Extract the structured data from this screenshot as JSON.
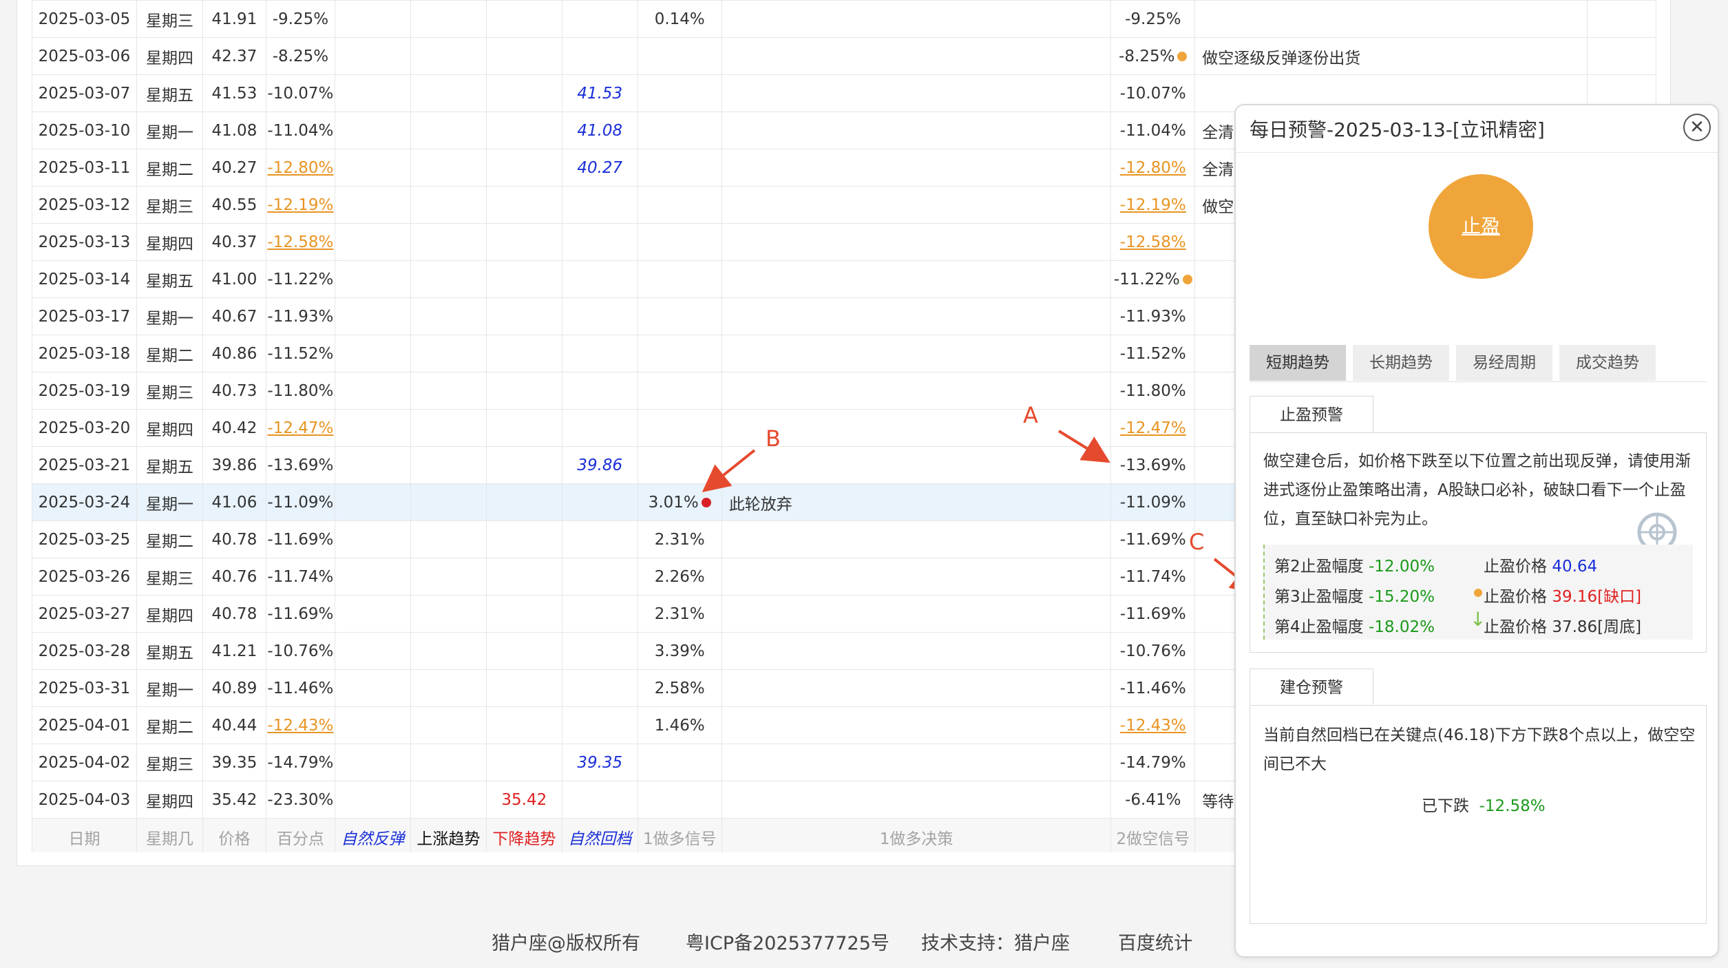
{
  "table": {
    "rows": [
      {
        "date": "2025-03-05",
        "weekday": "星期三",
        "price": "41.91",
        "pct": "-9.25%",
        "pct_orange": false,
        "rebound": "",
        "up": "",
        "down": "",
        "pullback": "",
        "signal1": "0.14%",
        "decision1": "",
        "signal2": "-9.25%",
        "signal2_orange": false,
        "dot": "",
        "note": ""
      },
      {
        "date": "2025-03-06",
        "weekday": "星期四",
        "price": "42.37",
        "pct": "-8.25%",
        "pct_orange": false,
        "rebound": "",
        "up": "",
        "down": "",
        "pullback": "",
        "signal1": "",
        "decision1": "",
        "signal2": "-8.25%",
        "signal2_orange": false,
        "dot": "orange",
        "note": "做空逐级反弹逐份出货"
      },
      {
        "date": "2025-03-07",
        "weekday": "星期五",
        "price": "41.53",
        "pct": "-10.07%",
        "pct_orange": false,
        "rebound": "",
        "up": "",
        "down": "",
        "pullback": "41.53",
        "signal1": "",
        "decision1": "",
        "signal2": "-10.07%",
        "signal2_orange": false,
        "dot": "",
        "note": ""
      },
      {
        "date": "2025-03-10",
        "weekday": "星期一",
        "price": "41.08",
        "pct": "-11.04%",
        "pct_orange": false,
        "rebound": "",
        "up": "",
        "down": "",
        "pullback": "41.08",
        "signal1": "",
        "decision1": "",
        "signal2": "-11.04%",
        "signal2_orange": false,
        "dot": "",
        "note": "全清"
      },
      {
        "date": "2025-03-11",
        "weekday": "星期二",
        "price": "40.27",
        "pct": "-12.80%",
        "pct_orange": true,
        "rebound": "",
        "up": "",
        "down": "",
        "pullback": "40.27",
        "signal1": "",
        "decision1": "",
        "signal2": "-12.80%",
        "signal2_orange": true,
        "dot": "",
        "note": "全清"
      },
      {
        "date": "2025-03-12",
        "weekday": "星期三",
        "price": "40.55",
        "pct": "-12.19%",
        "pct_orange": true,
        "rebound": "",
        "up": "",
        "down": "",
        "pullback": "",
        "signal1": "",
        "decision1": "",
        "signal2": "-12.19%",
        "signal2_orange": true,
        "dot": "",
        "note": "做空"
      },
      {
        "date": "2025-03-13",
        "weekday": "星期四",
        "price": "40.37",
        "pct": "-12.58%",
        "pct_orange": true,
        "rebound": "",
        "up": "",
        "down": "",
        "pullback": "",
        "signal1": "",
        "decision1": "",
        "signal2": "-12.58%",
        "signal2_orange": true,
        "dot": "",
        "note": ""
      },
      {
        "date": "2025-03-14",
        "weekday": "星期五",
        "price": "41.00",
        "pct": "-11.22%",
        "pct_orange": false,
        "rebound": "",
        "up": "",
        "down": "",
        "pullback": "",
        "signal1": "",
        "decision1": "",
        "signal2": "-11.22%",
        "signal2_orange": false,
        "dot": "orange",
        "note": ""
      },
      {
        "date": "2025-03-17",
        "weekday": "星期一",
        "price": "40.67",
        "pct": "-11.93%",
        "pct_orange": false,
        "rebound": "",
        "up": "",
        "down": "",
        "pullback": "",
        "signal1": "",
        "decision1": "",
        "signal2": "-11.93%",
        "signal2_orange": false,
        "dot": "",
        "note": ""
      },
      {
        "date": "2025-03-18",
        "weekday": "星期二",
        "price": "40.86",
        "pct": "-11.52%",
        "pct_orange": false,
        "rebound": "",
        "up": "",
        "down": "",
        "pullback": "",
        "signal1": "",
        "decision1": "",
        "signal2": "-11.52%",
        "signal2_orange": false,
        "dot": "",
        "note": ""
      },
      {
        "date": "2025-03-19",
        "weekday": "星期三",
        "price": "40.73",
        "pct": "-11.80%",
        "pct_orange": false,
        "rebound": "",
        "up": "",
        "down": "",
        "pullback": "",
        "signal1": "",
        "decision1": "",
        "signal2": "-11.80%",
        "signal2_orange": false,
        "dot": "",
        "note": ""
      },
      {
        "date": "2025-03-20",
        "weekday": "星期四",
        "price": "40.42",
        "pct": "-12.47%",
        "pct_orange": true,
        "rebound": "",
        "up": "",
        "down": "",
        "pullback": "",
        "signal1": "",
        "decision1": "",
        "signal2": "-12.47%",
        "signal2_orange": true,
        "dot": "",
        "note": ""
      },
      {
        "date": "2025-03-21",
        "weekday": "星期五",
        "price": "39.86",
        "pct": "-13.69%",
        "pct_orange": false,
        "rebound": "",
        "up": "",
        "down": "",
        "pullback": "39.86",
        "signal1": "",
        "decision1": "",
        "signal2": "-13.69%",
        "signal2_orange": false,
        "dot": "",
        "note": ""
      },
      {
        "date": "2025-03-24",
        "weekday": "星期一",
        "price": "41.06",
        "pct": "-11.09%",
        "pct_orange": false,
        "rebound": "",
        "up": "",
        "down": "",
        "pullback": "",
        "signal1": "3.01%",
        "signal1_dot": "red",
        "decision1": "此轮放弃",
        "signal2": "-11.09%",
        "signal2_orange": false,
        "dot": "",
        "note": "",
        "highlight": true
      },
      {
        "date": "2025-03-25",
        "weekday": "星期二",
        "price": "40.78",
        "pct": "-11.69%",
        "pct_orange": false,
        "rebound": "",
        "up": "",
        "down": "",
        "pullback": "",
        "signal1": "2.31%",
        "decision1": "",
        "signal2": "-11.69%",
        "signal2_orange": false,
        "dot": "",
        "note": ""
      },
      {
        "date": "2025-03-26",
        "weekday": "星期三",
        "price": "40.76",
        "pct": "-11.74%",
        "pct_orange": false,
        "rebound": "",
        "up": "",
        "down": "",
        "pullback": "",
        "signal1": "2.26%",
        "decision1": "",
        "signal2": "-11.74%",
        "signal2_orange": false,
        "dot": "",
        "note": ""
      },
      {
        "date": "2025-03-27",
        "weekday": "星期四",
        "price": "40.78",
        "pct": "-11.69%",
        "pct_orange": false,
        "rebound": "",
        "up": "",
        "down": "",
        "pullback": "",
        "signal1": "2.31%",
        "decision1": "",
        "signal2": "-11.69%",
        "signal2_orange": false,
        "dot": "",
        "note": ""
      },
      {
        "date": "2025-03-28",
        "weekday": "星期五",
        "price": "41.21",
        "pct": "-10.76%",
        "pct_orange": false,
        "rebound": "",
        "up": "",
        "down": "",
        "pullback": "",
        "signal1": "3.39%",
        "decision1": "",
        "signal2": "-10.76%",
        "signal2_orange": false,
        "dot": "",
        "note": ""
      },
      {
        "date": "2025-03-31",
        "weekday": "星期一",
        "price": "40.89",
        "pct": "-11.46%",
        "pct_orange": false,
        "rebound": "",
        "up": "",
        "down": "",
        "pullback": "",
        "signal1": "2.58%",
        "decision1": "",
        "signal2": "-11.46%",
        "signal2_orange": false,
        "dot": "",
        "note": ""
      },
      {
        "date": "2025-04-01",
        "weekday": "星期二",
        "price": "40.44",
        "pct": "-12.43%",
        "pct_orange": true,
        "rebound": "",
        "up": "",
        "down": "",
        "pullback": "",
        "signal1": "1.46%",
        "decision1": "",
        "signal2": "-12.43%",
        "signal2_orange": true,
        "dot": "",
        "note": ""
      },
      {
        "date": "2025-04-02",
        "weekday": "星期三",
        "price": "39.35",
        "pct": "-14.79%",
        "pct_orange": false,
        "rebound": "",
        "up": "",
        "down": "",
        "pullback": "39.35",
        "signal1": "",
        "decision1": "",
        "signal2": "-14.79%",
        "signal2_orange": false,
        "dot": "",
        "note": ""
      },
      {
        "date": "2025-04-03",
        "weekday": "星期四",
        "price": "35.42",
        "pct": "-23.30%",
        "pct_orange": false,
        "rebound": "",
        "up": "",
        "down": "35.42",
        "pullback": "",
        "signal1": "",
        "decision1": "",
        "signal2": "-6.41%",
        "signal2_orange": false,
        "dot": "",
        "note": "等待"
      }
    ],
    "footer": [
      "日期",
      "星期几",
      "价格",
      "百分点",
      "自然反弹",
      "上涨趋势",
      "下降趋势",
      "自然回档",
      "1做多信号",
      "1做多决策",
      "2做空信号"
    ]
  },
  "annotations": {
    "a": "A",
    "b": "B",
    "c": "C"
  },
  "footer": {
    "copyright": "猎户座@版权所有",
    "icp": "粤ICP备2025377725号",
    "support": "技术支持：猎户座",
    "stats": "百度统计"
  },
  "popup": {
    "title": "每日预警-2025-03-13-[立讯精密]",
    "close": "✕",
    "status": "止盈",
    "status_color": "#f0a53a",
    "tabs": [
      "短期趋势",
      "长期趋势",
      "易经周期",
      "成交趋势"
    ],
    "active_tab": "短期趋势",
    "stop_section_title": "止盈预警",
    "stop_text": "做空建仓后，如价格下跌至以下位置之前出现反弹，请使用渐进式逐份止盈策略出清，A股缺口必补，破缺口看下一个止盈位，直至缺口补完为止。",
    "stops": [
      {
        "label": "第2止盈幅度",
        "pct": "-12.00%",
        "price_label": "止盈价格",
        "price": "40.64",
        "suffix": ""
      },
      {
        "label": "第3止盈幅度",
        "pct": "-15.20%",
        "price_label": "止盈价格",
        "price": "39.16",
        "suffix": "[缺口]"
      },
      {
        "label": "第4止盈幅度",
        "pct": "-18.02%",
        "price_label": "止盈价格",
        "price": "37.86",
        "suffix": "[周底]"
      }
    ],
    "build_section_title": "建仓预警",
    "build_text": "当前自然回档已在关键点(46.18)下方下跌8个点以上，做空空间已不大",
    "dropped_label": "已下跌",
    "dropped_value": "-12.58%"
  }
}
